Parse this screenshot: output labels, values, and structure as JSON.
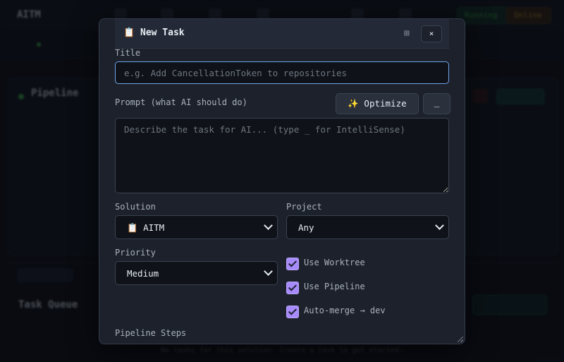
{
  "background": {
    "brand": "AITM",
    "pills": [
      "Running",
      "Online"
    ],
    "pipeline_title": "Pipeline",
    "queue_title": "Task Queue",
    "empty_message": "No tasks for this solution. Create a task to get started."
  },
  "modal": {
    "icon": "clipboard-icon",
    "title_icon_glyph": "📋",
    "title": "New Task",
    "expand_glyph": "⊞",
    "close_glyph": "×"
  },
  "form": {
    "title_label": "Title",
    "title_value": "",
    "title_placeholder": "e.g. Add CancellationToken to repositories",
    "prompt_label": "Prompt (what AI should do)",
    "optimize_label": "✨ Optimize",
    "intellisense_label": "_",
    "prompt_value": "",
    "prompt_placeholder": "Describe the task for AI... (type _ for IntelliSense)",
    "solution_label": "Solution",
    "solution_value": "📋 AITM",
    "project_label": "Project",
    "project_value": "Any",
    "priority_label": "Priority",
    "priority_value": "Medium",
    "checkboxes": [
      {
        "label": "Use Worktree",
        "checked": true
      },
      {
        "label": "Use Pipeline",
        "checked": true
      },
      {
        "label": "Auto-merge → dev",
        "checked": true
      }
    ],
    "pipeline_steps_label": "Pipeline Steps"
  },
  "colors": {
    "accent_checkbox": "#a78bfa",
    "focus_border": "#6fa4e8",
    "modal_bg": "#1c212b"
  }
}
